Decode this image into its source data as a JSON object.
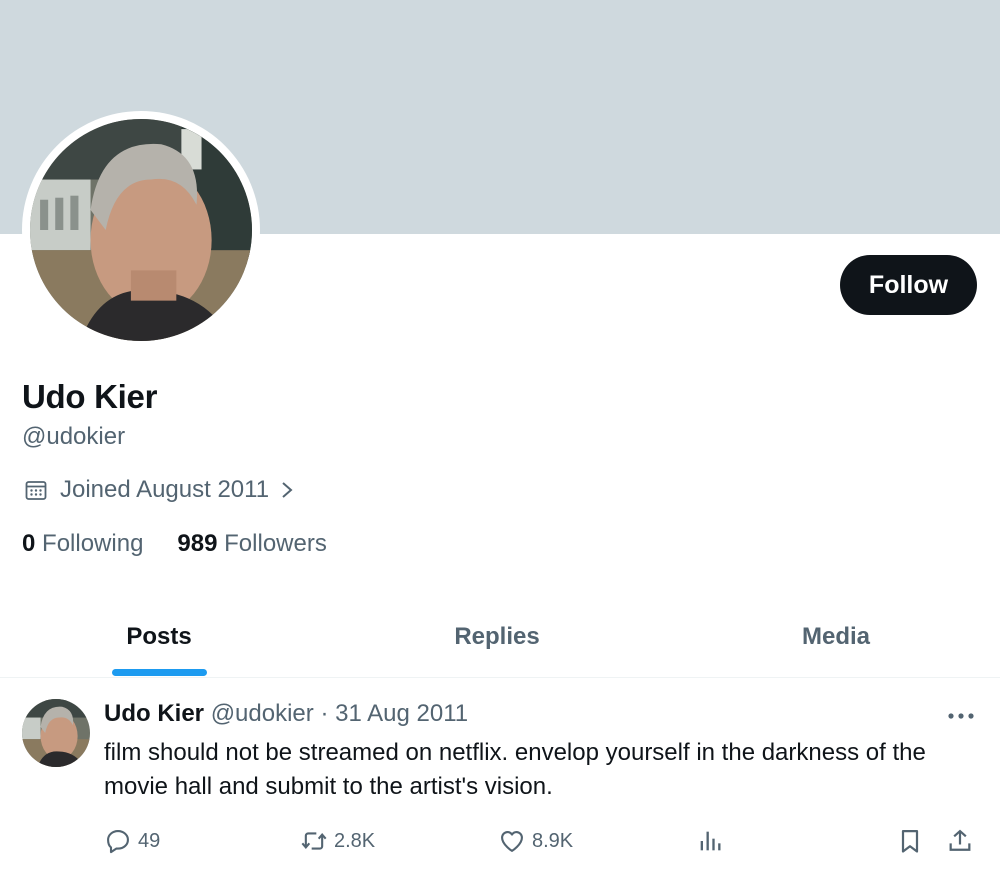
{
  "profile": {
    "display_name": "Udo Kier",
    "handle": "@udokier",
    "joined": "Joined August 2011",
    "following_count": "0",
    "following_label": "Following",
    "followers_count": "989",
    "followers_label": "Followers",
    "follow_label": "Follow"
  },
  "tabs": [
    {
      "label": "Posts",
      "active": true
    },
    {
      "label": "Replies",
      "active": false
    },
    {
      "label": "Media",
      "active": false
    }
  ],
  "post": {
    "author_name": "Udo Kier",
    "author_handle": "@udokier",
    "separator": "·",
    "date": "31 Aug 2011",
    "text": "film should not be streamed on netflix.  envelop yourself in the darkness of the movie hall and submit to the artist's vision.",
    "replies": "49",
    "retweets": "2.8K",
    "likes": "8.9K"
  },
  "icons": {
    "calendar": "calendar-icon",
    "chevron": "chevron-right-icon",
    "more": "more-icon",
    "reply": "reply-icon",
    "retweet": "retweet-icon",
    "like": "heart-icon",
    "views": "views-icon",
    "bookmark": "bookmark-icon",
    "share": "share-icon"
  },
  "colors": {
    "banner": "#cfd9de",
    "follow_button": "#0f1419",
    "accent": "#1d9bf0",
    "secondary_text": "#536471"
  }
}
